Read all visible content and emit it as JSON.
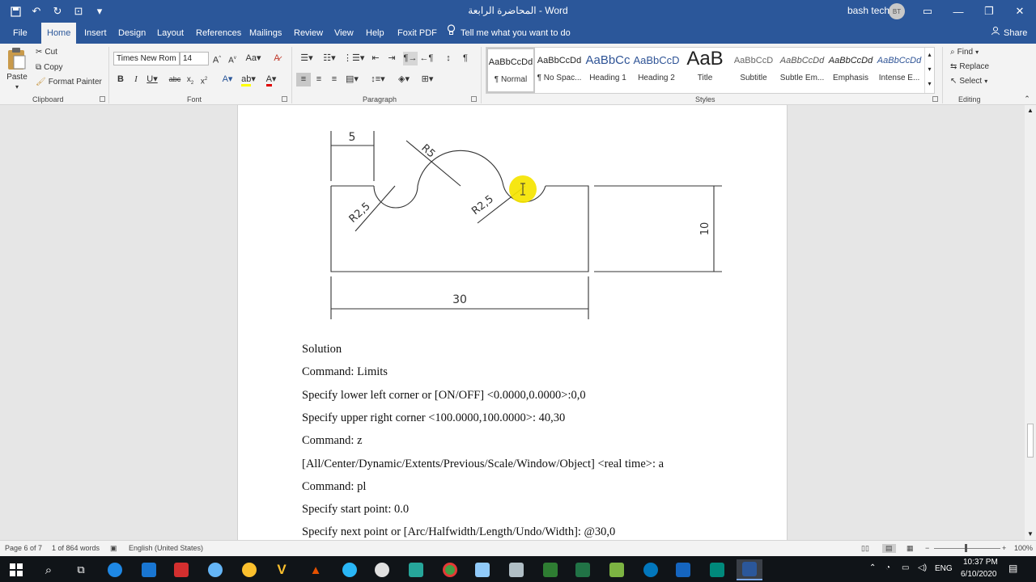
{
  "titlebar": {
    "doc_title": "المحاضرة الرابعة  -  Word",
    "user": "bash tech",
    "avatar": "BT",
    "qat_icons": [
      "save-icon",
      "undo-icon",
      "redo-icon",
      "touch-mode-icon",
      "customize-icon"
    ]
  },
  "tabs": [
    "File",
    "Home",
    "Insert",
    "Design",
    "Layout",
    "References",
    "Mailings",
    "Review",
    "View",
    "Help",
    "Foxit PDF"
  ],
  "active_tab": "Home",
  "tell_me": "Tell me what you want to do",
  "share": "Share",
  "clipboard": {
    "paste": "Paste",
    "cut": "Cut",
    "copy": "Copy",
    "format_painter": "Format Painter",
    "label": "Clipboard"
  },
  "font": {
    "name": "Times New Rom",
    "size": "14",
    "label": "Font"
  },
  "paragraph": {
    "label": "Paragraph"
  },
  "styles": {
    "label": "Styles",
    "items": [
      {
        "preview": "AaBbCcDd",
        "name": "¶ Normal"
      },
      {
        "preview": "AaBbCcDd",
        "name": "¶ No Spac..."
      },
      {
        "preview": "AaBbCc",
        "name": "Heading 1"
      },
      {
        "preview": "AaBbCcD",
        "name": "Heading 2"
      },
      {
        "preview": "AaB",
        "name": "Title"
      },
      {
        "preview": "AaBbCcD",
        "name": "Subtitle"
      },
      {
        "preview": "AaBbCcDd",
        "name": "Subtle Em..."
      },
      {
        "preview": "AaBbCcDd",
        "name": "Emphasis"
      },
      {
        "preview": "AaBbCcDd",
        "name": "Intense E..."
      }
    ]
  },
  "editing": {
    "find": "Find",
    "replace": "Replace",
    "select": "Select",
    "label": "Editing"
  },
  "drawing": {
    "dim_5": "5",
    "dim_r5": "R5",
    "dim_r25_left": "R2,5",
    "dim_r25_right": "R2,5",
    "dim_10": "10",
    "dim_30": "30"
  },
  "document_lines": [
    "Solution",
    "Command: Limits",
    "Specify lower left corner or [ON/OFF] <0.0000,0.0000>:0,0",
    "Specify upper right corner <100.0000,100.0000>: 40,30",
    "Command: z",
    "[All/Center/Dynamic/Extents/Previous/Scale/Window/Object] <real time>: a",
    "Command: pl",
    "Specify start point: 0.0",
    "Specify next point or [Arc/Halfwidth/Length/Undo/Width]: @30,0"
  ],
  "statusbar": {
    "page": "Page 6 of 7",
    "words": "1 of 864 words",
    "language": "English (United States)",
    "zoom": "100%"
  },
  "taskbar": {
    "language": "ENG",
    "time": "10:37 PM",
    "date": "6/10/2020"
  },
  "colors": {
    "word_blue": "#2b579a",
    "highlight": "#ffff00",
    "cursor_circle": "#f5e400"
  }
}
